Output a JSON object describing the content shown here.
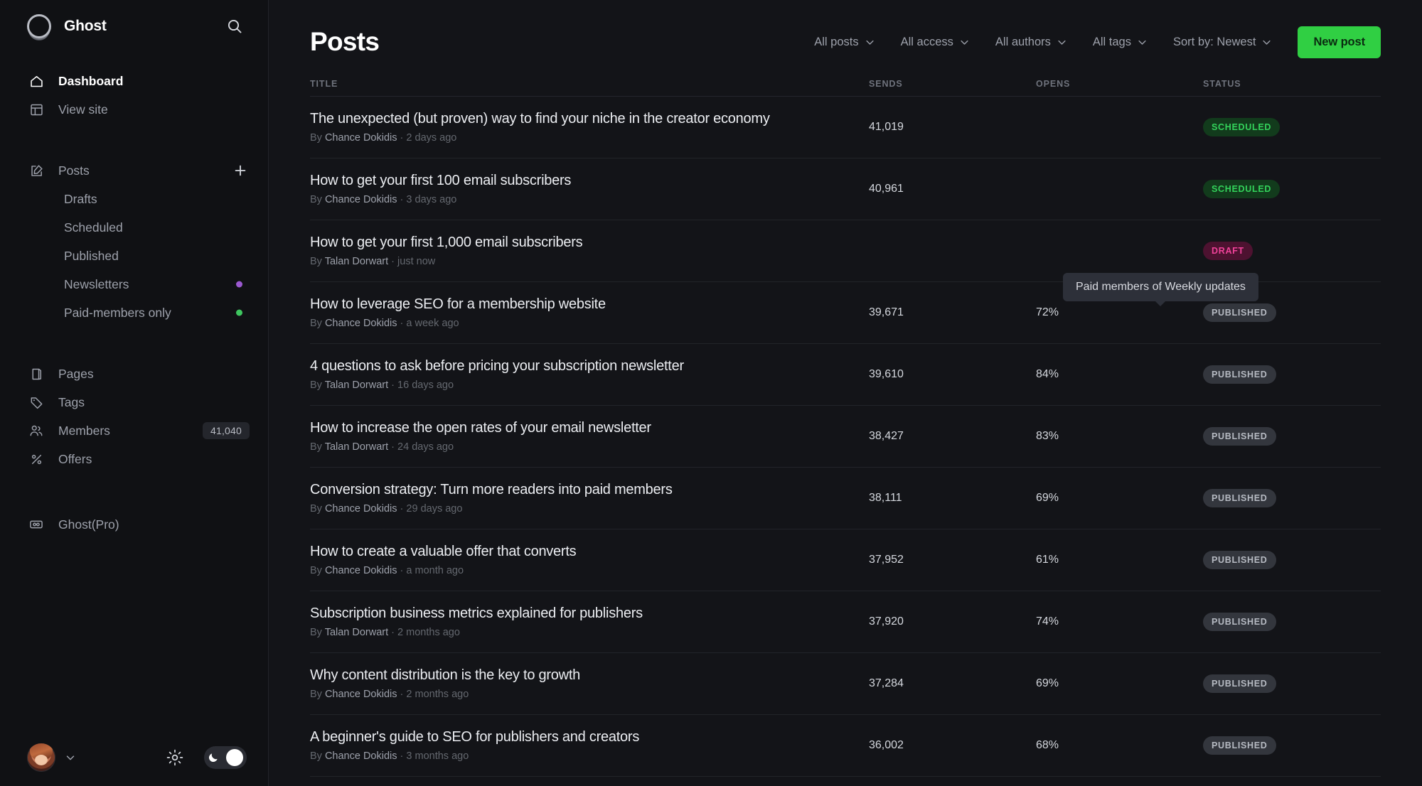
{
  "sidebar": {
    "brand": {
      "name": "Ghost",
      "logo_icon": "ghost-logo-icon"
    },
    "search_icon": "search-icon",
    "items": [
      {
        "label": "Dashboard",
        "icon": "home-icon",
        "active": true
      },
      {
        "label": "View site",
        "icon": "layout-icon",
        "active": false
      },
      {
        "label": "Posts",
        "icon": "edit-pencil-icon",
        "active": false,
        "action_icon": "plus-icon"
      },
      {
        "label": "Drafts",
        "sub": true
      },
      {
        "label": "Scheduled",
        "sub": true
      },
      {
        "label": "Published",
        "sub": true
      },
      {
        "label": "Newsletters",
        "sub": true,
        "dot": "#9b59d0"
      },
      {
        "label": "Paid-members only",
        "sub": true,
        "dot": "#3ec65f"
      },
      {
        "label": "Pages",
        "icon": "book-icon"
      },
      {
        "label": "Tags",
        "icon": "tag-icon"
      },
      {
        "label": "Members",
        "icon": "members-icon",
        "count": "41,040"
      },
      {
        "label": "Offers",
        "icon": "percent-icon"
      },
      {
        "label": "Ghost(Pro)",
        "icon": "ghost-pro-icon"
      }
    ],
    "bottom": {
      "avatar_icon": "avatar",
      "chevron_icon": "chevron-down-icon",
      "gear_icon": "gear-icon",
      "theme_toggle_icon": "moon-icon",
      "theme_toggle_on": true
    }
  },
  "header": {
    "title": "Posts",
    "filters": [
      {
        "label": "All posts"
      },
      {
        "label": "All access"
      },
      {
        "label": "All authors"
      },
      {
        "label": "All tags"
      },
      {
        "label": "Sort by: Newest"
      }
    ],
    "new_post_label": "New post"
  },
  "table": {
    "columns": {
      "title": "TITLE",
      "sends": "SENDS",
      "opens": "OPENS",
      "status": "STATUS"
    },
    "rows": [
      {
        "title": "The unexpected (but proven) way to find your niche in the creator economy",
        "by_prefix": "By ",
        "author": "Chance Dokidis",
        "sep": " · ",
        "time": "2 days ago",
        "sends": "41,019",
        "opens": "",
        "status": "SCHEDULED",
        "status_kind": "scheduled"
      },
      {
        "title": "How to get your first 100 email subscribers",
        "by_prefix": "By ",
        "author": "Chance Dokidis",
        "sep": " · ",
        "time": "3 days ago",
        "sends": "40,961",
        "opens": "",
        "status": "SCHEDULED",
        "status_kind": "scheduled"
      },
      {
        "title": "How to get your first 1,000 email subscribers",
        "by_prefix": "By ",
        "author": "Talan Dorwart",
        "sep": " · ",
        "time": "just now",
        "sends": "",
        "opens": "",
        "status": "DRAFT",
        "status_kind": "draft"
      },
      {
        "title": "How to leverage SEO for a membership website",
        "by_prefix": "By ",
        "author": "Chance Dokidis",
        "sep": " · ",
        "time": "a week ago",
        "sends": "39,671",
        "opens": "72%",
        "status": "PUBLISHED",
        "status_kind": "published"
      },
      {
        "title": "4 questions to ask before pricing your subscription newsletter",
        "by_prefix": "By ",
        "author": "Talan Dorwart",
        "sep": " · ",
        "time": "16 days ago",
        "sends": "39,610",
        "opens": "84%",
        "status": "PUBLISHED",
        "status_kind": "published"
      },
      {
        "title": "How to increase the open rates of your email newsletter",
        "by_prefix": "By ",
        "author": "Talan Dorwart",
        "sep": " · ",
        "time": "24 days ago",
        "sends": "38,427",
        "opens": "83%",
        "status": "PUBLISHED",
        "status_kind": "published"
      },
      {
        "title": "Conversion strategy: Turn more readers into paid members",
        "by_prefix": "By ",
        "author": "Chance Dokidis",
        "sep": " · ",
        "time": "29 days ago",
        "sends": "38,111",
        "opens": "69%",
        "status": "PUBLISHED",
        "status_kind": "published"
      },
      {
        "title": "How to create a valuable offer that converts",
        "by_prefix": "By ",
        "author": "Chance Dokidis",
        "sep": " · ",
        "time": "a month ago",
        "sends": "37,952",
        "opens": "61%",
        "status": "PUBLISHED",
        "status_kind": "published"
      },
      {
        "title": "Subscription business metrics explained for publishers",
        "by_prefix": "By ",
        "author": "Talan Dorwart",
        "sep": " · ",
        "time": "2 months ago",
        "sends": "37,920",
        "opens": "74%",
        "status": "PUBLISHED",
        "status_kind": "published"
      },
      {
        "title": "Why content distribution is the key to growth",
        "by_prefix": "By ",
        "author": "Chance Dokidis",
        "sep": " · ",
        "time": "2 months ago",
        "sends": "37,284",
        "opens": "69%",
        "status": "PUBLISHED",
        "status_kind": "published"
      },
      {
        "title": "A beginner's guide to SEO for publishers and creators",
        "by_prefix": "By ",
        "author": "Chance Dokidis",
        "sep": " · ",
        "time": "3 months ago",
        "sends": "36,002",
        "opens": "68%",
        "status": "PUBLISHED",
        "status_kind": "published"
      }
    ]
  },
  "tooltip": {
    "text": "Paid members of Weekly updates"
  },
  "colors": {
    "accent_green": "#30cf43",
    "newsletter_dot": "#9b59d0",
    "paid_dot": "#3ec65f"
  }
}
